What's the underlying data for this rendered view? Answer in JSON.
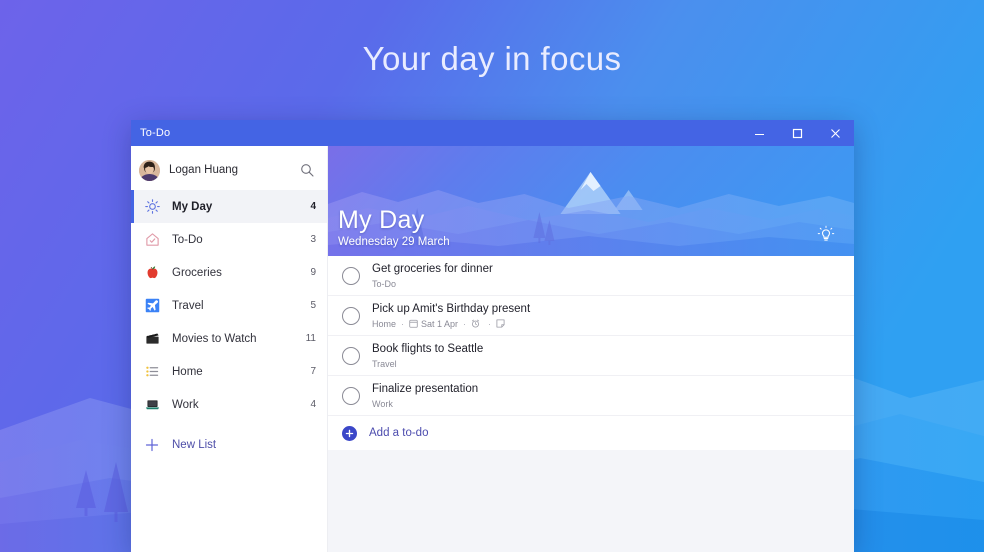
{
  "promo": {
    "headline": "Your day in focus"
  },
  "window": {
    "title": "To-Do",
    "controls": {
      "minimize": "minimize-button",
      "maximize": "maximize-button",
      "close": "close-button"
    }
  },
  "sidebar": {
    "account": {
      "name": "Logan Huang",
      "avatar_icon": "avatar",
      "search_icon": "search-icon"
    },
    "items": [
      {
        "label": "My Day",
        "count": "4",
        "icon": "sun-icon",
        "selected": true
      },
      {
        "label": "To-Do",
        "count": "3",
        "icon": "house-check-icon",
        "selected": false
      },
      {
        "label": "Groceries",
        "count": "9",
        "icon": "apple-icon",
        "selected": false
      },
      {
        "label": "Travel",
        "count": "5",
        "icon": "airplane-icon",
        "selected": false
      },
      {
        "label": "Movies to Watch",
        "count": "11",
        "icon": "clapperboard-icon",
        "selected": false
      },
      {
        "label": "Home",
        "count": "7",
        "icon": "list-icon",
        "selected": false
      },
      {
        "label": "Work",
        "count": "4",
        "icon": "laptop-icon",
        "selected": false
      }
    ],
    "new_list": {
      "label": "New List",
      "icon": "plus-icon"
    }
  },
  "main": {
    "hero": {
      "title": "My Day",
      "date": "Wednesday 29 March",
      "suggestions_icon": "lightbulb-icon"
    },
    "tasks": [
      {
        "title": "Get groceries for dinner",
        "list": "To-Do",
        "due": "",
        "has_due_icon": false,
        "has_reminder_icon": false,
        "has_note_icon": false
      },
      {
        "title": "Pick up Amit's Birthday present",
        "list": "Home",
        "due": "Sat 1 Apr",
        "has_due_icon": true,
        "has_reminder_icon": true,
        "has_note_icon": true
      },
      {
        "title": "Book flights to Seattle",
        "list": "Travel",
        "due": "",
        "has_due_icon": false,
        "has_reminder_icon": false,
        "has_note_icon": false
      },
      {
        "title": "Finalize presentation",
        "list": "Work",
        "due": "",
        "has_due_icon": false,
        "has_reminder_icon": false,
        "has_note_icon": false
      }
    ],
    "add_todo": {
      "label": "Add a to-do",
      "icon": "plus-circle-icon"
    }
  },
  "colors": {
    "accent": "#4464e4",
    "titlebar": "#4464e4",
    "selected_bar": "#4464e4",
    "add_plus": "#3b47c8",
    "link_text": "#4c4cae",
    "bg_left": "#6a63e8",
    "bg_right": "#2e9bf0"
  }
}
